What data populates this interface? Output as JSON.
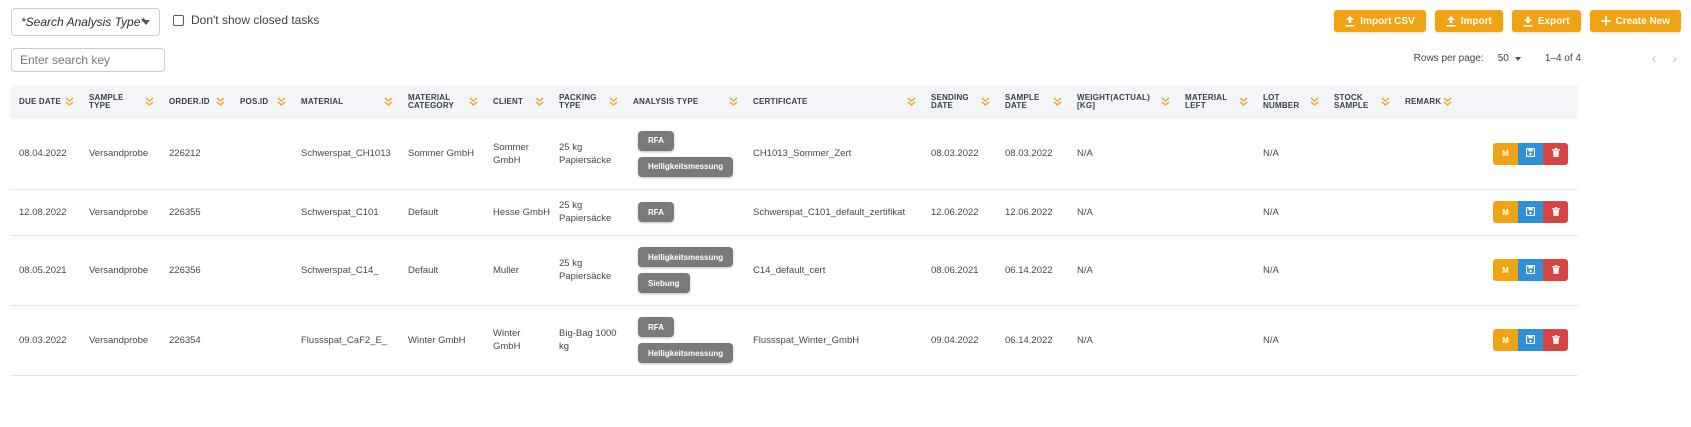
{
  "toolbar": {
    "analysis_type_select": "*Search Analysis Type*",
    "closed_tasks_label": "Don't show closed tasks",
    "import_csv_label": "Import CSV",
    "import_label": "Import",
    "export_label": "Export",
    "create_new_label": "Create New"
  },
  "search": {
    "placeholder": "Enter search key",
    "value": ""
  },
  "pagination": {
    "rows_per_page_label": "Rows per page:",
    "rows_per_page": "50",
    "range": "1–4 of 4"
  },
  "columns": [
    {
      "label": "DUE DATE"
    },
    {
      "label": "SAMPLE TYPE"
    },
    {
      "label": "ORDER.ID"
    },
    {
      "label": "POS.ID"
    },
    {
      "label": "MATERIAL"
    },
    {
      "label": "MATERIAL CATEGORY"
    },
    {
      "label": "CLIENT"
    },
    {
      "label": "PACKING TYPE"
    },
    {
      "label": "ANALYSIS TYPE"
    },
    {
      "label": "CERTIFICATE"
    },
    {
      "label": "SENDING DATE"
    },
    {
      "label": "SAMPLE DATE"
    },
    {
      "label": "WEIGHT(ACTUAL) [KG]"
    },
    {
      "label": "MATERIAL LEFT"
    },
    {
      "label": "LOT NUMBER"
    },
    {
      "label": "STOCK SAMPLE"
    },
    {
      "label": "REMARK"
    }
  ],
  "rows": [
    {
      "due_date": "08.04.2022",
      "sample_type": "Versandprobe",
      "order_id": "226212",
      "pos_id": "",
      "material": "Schwerspat_CH1013",
      "material_category": "Sommer GmbH",
      "client": "Sommer GmbH",
      "packing_type": "25 kg Papiersäcke",
      "analysis_types": [
        "RFA",
        "Helligkeitsmessung"
      ],
      "certificate": "CH1013_Sommer_Zert",
      "sending_date": "08.03.2022",
      "sample_date": "08.03.2022",
      "weight": "N/A",
      "material_left": "",
      "lot_number": "N/A",
      "stock_sample": "",
      "remark": ""
    },
    {
      "due_date": "12.08.2022",
      "sample_type": "Versandprobe",
      "order_id": "226355",
      "pos_id": "",
      "material": "Schwerspat_C101",
      "material_category": "Default",
      "client": "Hesse GmbH",
      "packing_type": "25 kg Papiersäcke",
      "analysis_types": [
        "RFA"
      ],
      "certificate": "Schwerspat_C101_default_zertifikat",
      "sending_date": "12.06.2022",
      "sample_date": "12.06.2022",
      "weight": "N/A",
      "material_left": "",
      "lot_number": "N/A",
      "stock_sample": "",
      "remark": ""
    },
    {
      "due_date": "08.05.2021",
      "sample_type": "Versandprobe",
      "order_id": "226356",
      "pos_id": "",
      "material": "Schwerspat_C14_",
      "material_category": "Default",
      "client": "Muller",
      "packing_type": "25 kg Papiersäcke",
      "analysis_types": [
        "Helligkeitsmessung",
        "Siebung"
      ],
      "certificate": "C14_default_cert",
      "sending_date": "08.06.2021",
      "sample_date": "06.14.2022",
      "weight": "N/A",
      "material_left": "",
      "lot_number": "N/A",
      "stock_sample": "",
      "remark": ""
    },
    {
      "due_date": "09.03.2022",
      "sample_type": "Versandprobe",
      "order_id": "226354",
      "pos_id": "",
      "material": "Flussspat_CaF2_E_",
      "material_category": "Winter GmbH",
      "client": "Winter GmbH",
      "packing_type": "Big-Bag 1000 kg",
      "analysis_types": [
        "RFA",
        "Helligkeitsmessung"
      ],
      "certificate": "Flussspat_Winter_GmbH",
      "sending_date": "09.04.2022",
      "sample_date": "06.14.2022",
      "weight": "N/A",
      "material_left": "",
      "lot_number": "N/A",
      "stock_sample": "",
      "remark": ""
    }
  ],
  "row_actions": {
    "edit_label": "M",
    "save_icon": "save-icon",
    "delete_icon": "trash-icon"
  },
  "icons": {
    "upload": "upload-icon",
    "download": "download-icon",
    "plus": "plus-icon",
    "sort": "chevrons-down-icon",
    "dropdown": "caret-down-icon",
    "prev": "chevron-left-icon",
    "next": "chevron-right-icon"
  },
  "colors": {
    "accent": "#f0a413",
    "save": "#2f8fd8",
    "delete": "#d84444",
    "chip": "#7a7a7a",
    "header_bg": "#f3f5f8"
  }
}
